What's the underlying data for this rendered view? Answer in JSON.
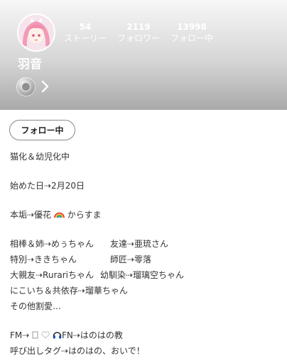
{
  "profile": {
    "name": "羽音",
    "stats": [
      {
        "count": "54",
        "label": "ストーリー"
      },
      {
        "count": "2119",
        "label": "フォロワー"
      },
      {
        "count": "13998",
        "label": "フォロー中"
      }
    ]
  },
  "follow_button": "フォロー中",
  "bio": {
    "line1": "猫化＆幼児化中",
    "line2": "始めた日⇢2月20日",
    "line3_text": "本垢⇢優花",
    "line3_tail": "からすま",
    "r1a": "相棒＆姉⇢めぅちゃん",
    "r1b": "友達⇢亜琉さん",
    "r2a": "特別⇢ききちゃん",
    "r2b": "師匠⇢零落",
    "r3a": "大親友⇢Rurariちゃん",
    "r3b": "幼馴染⇢瑠璃空ちゃん",
    "r4": "にこいち＆共依存⇢瑠華ちゃん",
    "r5": "その他割愛…",
    "fm_label": "FM⇢",
    "fn": "FN⇢はのはの教",
    "call": "呼び出しタグ⇢はのはの、おいで！"
  },
  "icons": [
    "avatar-image",
    "badge-icon",
    "chevron-right-icon",
    "rainbow-icon",
    "heart-icon",
    "headphones-icon"
  ]
}
